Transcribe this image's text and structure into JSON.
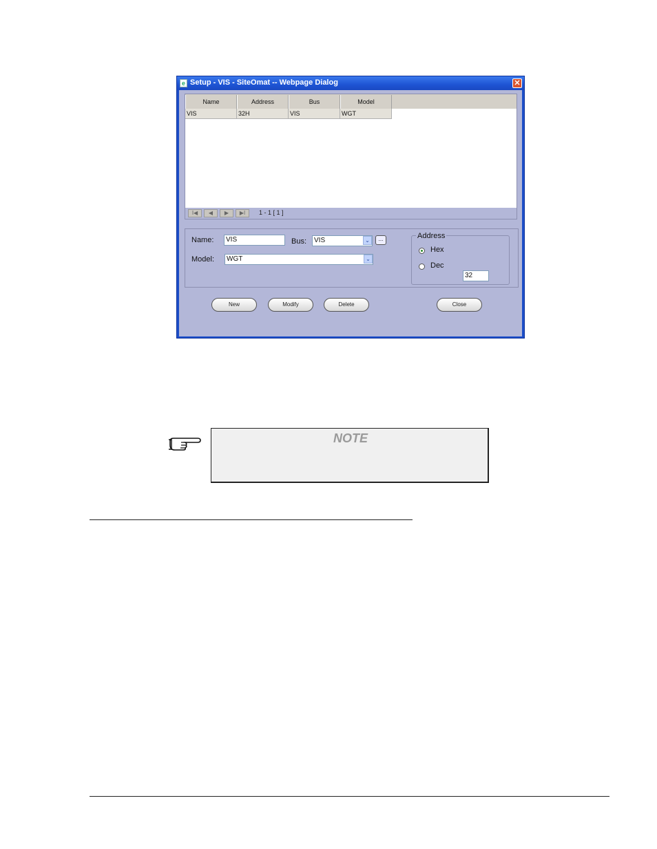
{
  "window": {
    "title": "Setup - VIS - SiteOmat -- Webpage Dialog",
    "close_glyph": "✕"
  },
  "grid": {
    "columns": [
      "Name",
      "Address",
      "Bus",
      "Model"
    ],
    "rows": [
      [
        "VIS",
        "32H",
        "VIS",
        "WGT"
      ]
    ],
    "pager": {
      "first": "I◀",
      "prev": "◀",
      "next": "▶",
      "last": "▶I",
      "info": "1 - 1  [ 1 ]"
    }
  },
  "form": {
    "name_label": "Name:",
    "name_value": "VIS",
    "bus_label": "Bus:",
    "bus_value": "VIS",
    "bus_browse": "...",
    "model_label": "Model:",
    "model_value": "WGT",
    "address": {
      "legend": "Address",
      "hex_label": "Hex",
      "dec_label": "Dec",
      "selected": "Hex",
      "value": "32"
    }
  },
  "buttons": {
    "new": "New",
    "modify": "Modify",
    "delete": "Delete",
    "close": "Close"
  },
  "note": {
    "title": "NOTE",
    "icon": "pointing-hand-icon"
  },
  "colors": {
    "titlebar": "#1e54d4",
    "client": "#b3b7d8"
  }
}
